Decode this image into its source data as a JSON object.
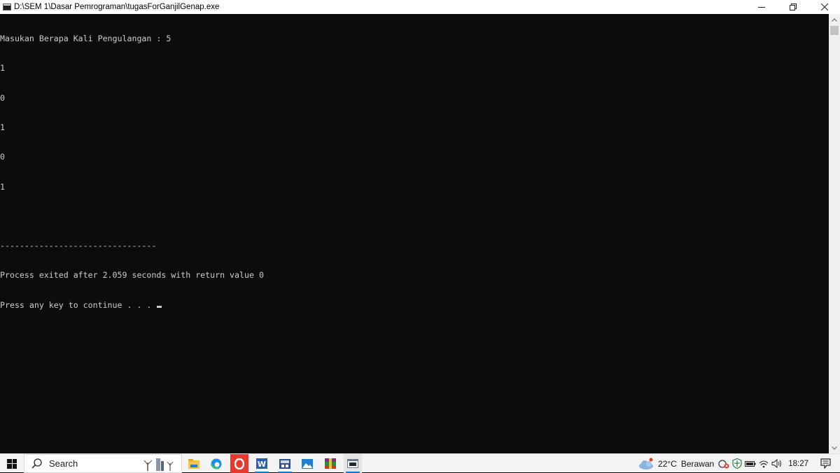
{
  "window": {
    "title": "D:\\SEM 1\\Dasar Pemrograman\\tugasForGanjilGenap.exe",
    "minimize": "—",
    "restore": "❐",
    "close": "✕"
  },
  "console": {
    "lines": [
      "Masukan Berapa Kali Pengulangan : 5",
      "1",
      "0",
      "1",
      "0",
      "1",
      "",
      "--------------------------------",
      "Process exited after 2.059 seconds with return value 0",
      "Press any key to continue . . . "
    ]
  },
  "taskbar": {
    "search_placeholder": "Search",
    "apps": [
      {
        "name": "file-explorer",
        "color": "#f5c542"
      },
      {
        "name": "edge",
        "color": "#1f8de0"
      },
      {
        "name": "opera",
        "color": "#e8392f"
      },
      {
        "name": "word",
        "color": "#2b5fb4"
      },
      {
        "name": "dev-cpp",
        "color": "#2f4f8f"
      },
      {
        "name": "photos",
        "color": "#1f7fd0"
      },
      {
        "name": "winrar",
        "color": "#8a2b8a"
      },
      {
        "name": "console-window",
        "color": "#6a7a8a"
      }
    ],
    "weather": {
      "temp": "22°C",
      "condition": "Berawan"
    },
    "clock": "18:27"
  },
  "colors": {
    "console_bg": "#0c0c0c",
    "console_fg": "#cccccc",
    "taskbar_bg": "#f3f3f3",
    "active_underline": "#1a73c8"
  }
}
